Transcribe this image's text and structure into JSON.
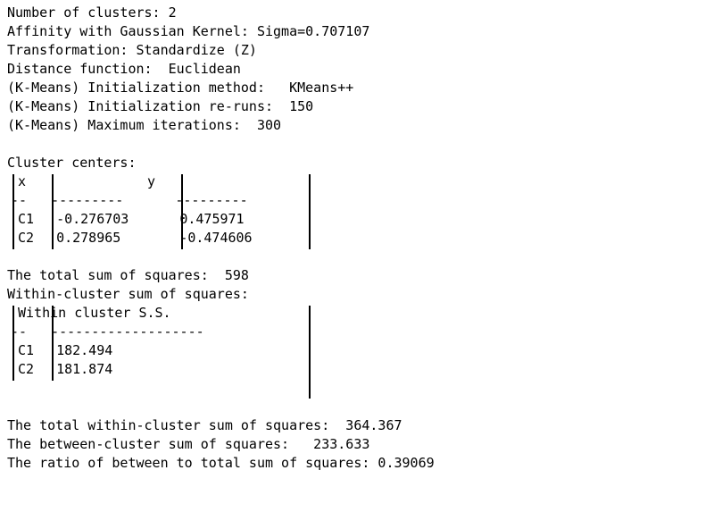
{
  "report": {
    "parameters": [
      {
        "label": "Number of clusters:",
        "value": "2",
        "text": "Number of clusters: 2"
      },
      {
        "label": "Affinity with Gaussian Kernel: Sigma=",
        "value": "0.707107",
        "text": "Affinity with Gaussian Kernel: Sigma=0.707107"
      },
      {
        "label": "Transformation:",
        "value": "Standardize (Z)",
        "text": "Transformation: Standardize (Z)"
      },
      {
        "label": "Distance function:",
        "value": "Euclidean",
        "text": "Distance function:  Euclidean"
      },
      {
        "label": "(K-Means) Initialization method:",
        "value": "KMeans++",
        "text": "(K-Means) Initialization method:   KMeans++"
      },
      {
        "label": "(K-Means) Initialization re-runs:",
        "value": "150",
        "text": "(K-Means) Initialization re-runs:  150"
      },
      {
        "label": "(K-Means) Maximum iterations:",
        "value": "300",
        "text": "(K-Means) Maximum iterations:  300"
      }
    ],
    "cluster_centers": {
      "title": "Cluster centers:",
      "row_header_label": "",
      "row_header_dashes": "--",
      "columns": [
        {
          "name": "x",
          "dashes": "---------"
        },
        {
          "name": "y",
          "dashes": "---------"
        }
      ],
      "rows": [
        {
          "name": "C1",
          "x": "-0.276703",
          "y": "0.475971"
        },
        {
          "name": "C2",
          "x": "0.278965",
          "y": "-0.474606"
        }
      ],
      "header_line": " │x        │y        │",
      "dash_line": "--│---------│---------│",
      "row_lines": [
        "C1│-0.276703│0.475971 │",
        "C2│0.278965 │-0.474606│"
      ]
    },
    "total_sum_of_squares": {
      "label": "The total sum of squares:",
      "value": "598",
      "text": "The total sum of squares:  598"
    },
    "within_cluster": {
      "title": "Within-cluster sum of squares:",
      "row_header_dashes": "--",
      "column_name": "Within cluster S.S.",
      "column_dashes": "-------------------",
      "rows": [
        {
          "name": "C1",
          "value": "182.494"
        },
        {
          "name": "C2",
          "value": "181.874"
        }
      ]
    },
    "summary": [
      {
        "label": "The total within-cluster sum of squares:",
        "value": "364.367",
        "text": "The total within-cluster sum of squares:  364.367"
      },
      {
        "label": "The between-cluster sum of squares:",
        "value": "233.633",
        "text": "The between-cluster sum of squares:   233.633"
      },
      {
        "label": "The ratio of between to total sum of squares:",
        "value": "0.39069",
        "text": "The ratio of between to total sum of squares: 0.39069"
      }
    ]
  }
}
